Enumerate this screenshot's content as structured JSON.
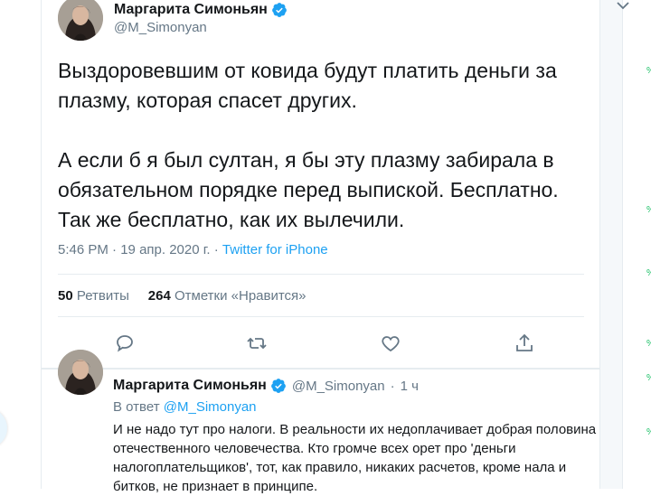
{
  "tweet": {
    "author_name": "Маргарита Симоньян",
    "author_handle": "@M_Simonyan",
    "text": "Выздоровевшим от ковида будут платить деньги за плазму, которая спасет других.\n\nА если б я был султан, я бы эту плазму забирала в обязательном порядке перед выпиской. Бесплатно. Так же бесплатно, как их вылечили.",
    "time": "5:46 PM",
    "dot": "·",
    "date": "19 апр. 2020 г.",
    "source": "Twitter for iPhone",
    "retweets_count": "50",
    "retweets_label": "Ретвиты",
    "likes_count": "264",
    "likes_label": "Отметки «Нравится»"
  },
  "reply": {
    "author_name": "Маргарита Симоньян",
    "author_handle": "@M_Simonyan",
    "dot": "·",
    "time_ago": "1 ч",
    "reply_prefix": "В ответ",
    "reply_handle": "@M_Simonyan",
    "text": "И не надо тут про налоги. В реальности их недоплачивает добрая половина отечественного человечества. Кто громче всех орет про 'деньги налогоплательщиков', тот, как правило, никаких расчетов, кроме нала и битков, не признает в принципе."
  },
  "icons": [
    "verified-badge-icon",
    "chevron-down-icon",
    "reply-icon",
    "retweet-icon",
    "like-icon",
    "share-icon"
  ],
  "colors": {
    "accent": "#1da1f2",
    "secondary_text": "#657786",
    "border": "#e6ecf0"
  }
}
